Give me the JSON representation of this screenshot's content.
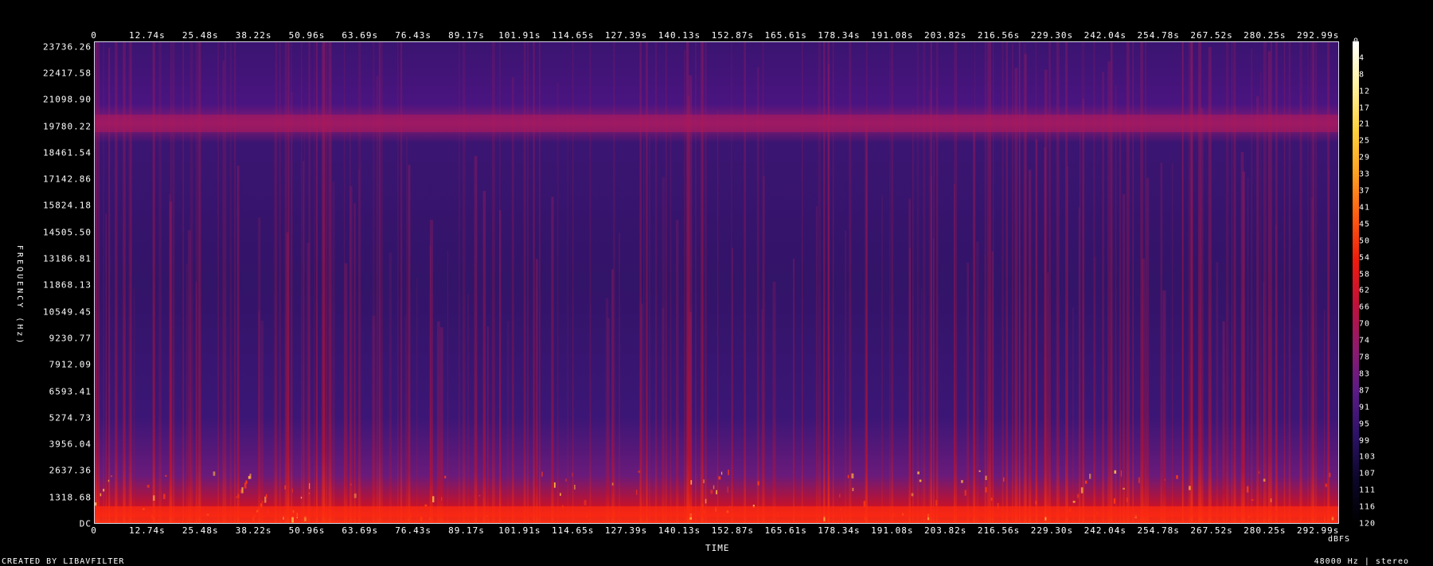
{
  "chart_data": {
    "type": "heatmap",
    "title": "",
    "xlabel": "TIME",
    "ylabel": "FREQUENCY (Hz)",
    "x_ticks": [
      "0",
      "12.74s",
      "25.48s",
      "38.22s",
      "50.96s",
      "63.69s",
      "76.43s",
      "89.17s",
      "101.91s",
      "114.65s",
      "127.39s",
      "140.13s",
      "152.87s",
      "165.61s",
      "178.34s",
      "191.08s",
      "203.82s",
      "216.56s",
      "229.30s",
      "242.04s",
      "254.78s",
      "267.52s",
      "280.25s",
      "292.99s"
    ],
    "x_tick_values": [
      0,
      12.74,
      25.48,
      38.22,
      50.96,
      63.69,
      76.43,
      89.17,
      101.91,
      114.65,
      127.39,
      140.13,
      152.87,
      165.61,
      178.34,
      191.08,
      203.82,
      216.56,
      229.3,
      242.04,
      254.78,
      267.52,
      280.25,
      292.99
    ],
    "xlim": [
      0,
      298
    ],
    "y_ticks": [
      "23736.26",
      "22417.58",
      "21098.90",
      "19780.22",
      "18461.54",
      "17142.86",
      "15824.18",
      "14505.50",
      "13186.81",
      "11868.13",
      "10549.45",
      "9230.77",
      "7912.09",
      "6593.41",
      "5274.73",
      "3956.04",
      "2637.36",
      "1318.68",
      "DC"
    ],
    "y_tick_values": [
      23736.26,
      22417.58,
      21098.9,
      19780.22,
      18461.54,
      17142.86,
      15824.18,
      14505.5,
      13186.81,
      11868.13,
      10549.45,
      9230.77,
      7912.09,
      6593.41,
      5274.73,
      3956.04,
      2637.36,
      1318.68,
      0
    ],
    "ylim": [
      0,
      24000
    ],
    "colorbar": {
      "unit": "dBFS",
      "ticks": [
        "0",
        "-4",
        "-8",
        "-12",
        "-17",
        "-21",
        "-25",
        "-29",
        "-33",
        "-37",
        "-41",
        "-45",
        "-50",
        "-54",
        "-58",
        "-62",
        "-66",
        "-70",
        "-74",
        "-78",
        "-83",
        "-87",
        "-91",
        "-95",
        "-99",
        "-103",
        "-107",
        "-111",
        "-116",
        "-120"
      ],
      "range": [
        -120,
        0
      ],
      "colors": [
        "#ffffff",
        "#fff3a0",
        "#ffd23c",
        "#ffa020",
        "#ff5a10",
        "#ee1a0c",
        "#c0103a",
        "#8e1a6e",
        "#5a1a86",
        "#2c1266",
        "#0c0628",
        "#000000"
      ]
    },
    "features": {
      "horizontal_band_hz": 19780.22,
      "strong_low_band_hz": [
        0,
        1318.68
      ]
    }
  },
  "footer": {
    "left": "CREATED BY LIBAVFILTER",
    "right": "48000 Hz | stereo"
  }
}
